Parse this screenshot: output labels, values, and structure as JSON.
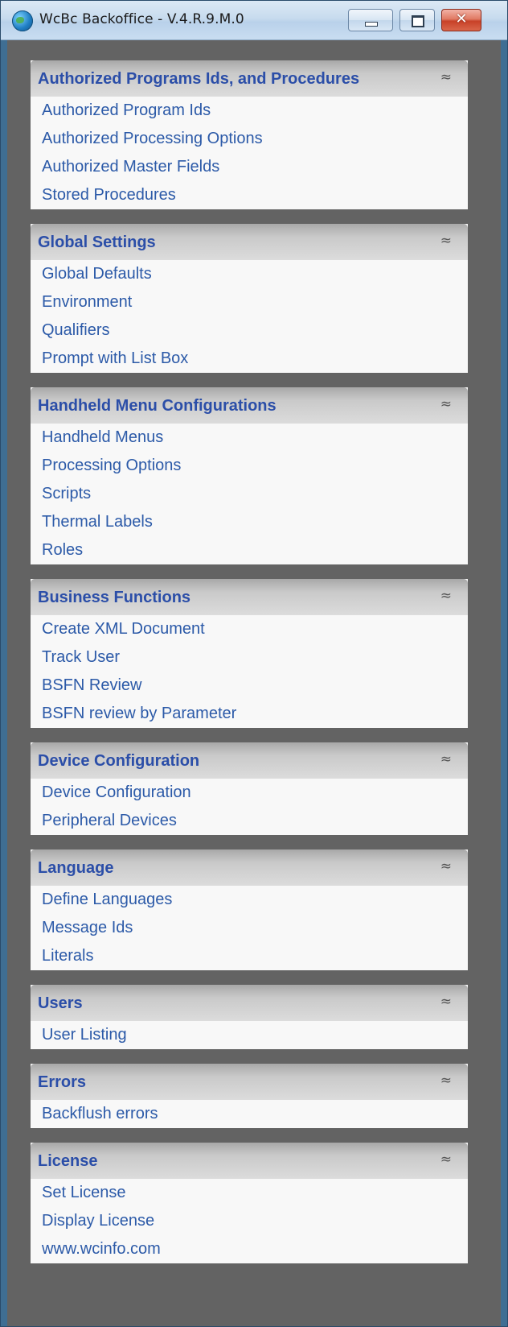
{
  "window": {
    "title": "WcBc Backoffice - V.4.R.9.M.0",
    "close_glyph": "✕"
  },
  "collapse_glyph": "≈",
  "panels": [
    {
      "title": "Authorized Programs Ids, and Procedures",
      "items": [
        "Authorized Program Ids",
        "Authorized Processing Options",
        "Authorized Master Fields",
        "Stored Procedures"
      ]
    },
    {
      "title": "Global Settings",
      "items": [
        "Global Defaults",
        "Environment",
        "Qualifiers",
        "Prompt with List Box"
      ]
    },
    {
      "title": "Handheld Menu Configurations",
      "items": [
        "Handheld Menus",
        "Processing Options",
        "Scripts",
        "Thermal Labels",
        "Roles"
      ]
    },
    {
      "title": "Business Functions",
      "items": [
        "Create XML Document",
        "Track User",
        "BSFN Review",
        "BSFN review by Parameter"
      ]
    },
    {
      "title": "Device Configuration",
      "items": [
        "Device Configuration",
        "Peripheral Devices"
      ]
    },
    {
      "title": "Language",
      "items": [
        "Define Languages",
        "Message Ids",
        "Literals"
      ]
    },
    {
      "title": "Users",
      "items": [
        "User Listing"
      ]
    },
    {
      "title": "Errors",
      "items": [
        "Backflush errors"
      ]
    },
    {
      "title": "License",
      "items": [
        "Set License",
        "Display License",
        "www.wcinfo.com"
      ]
    }
  ]
}
